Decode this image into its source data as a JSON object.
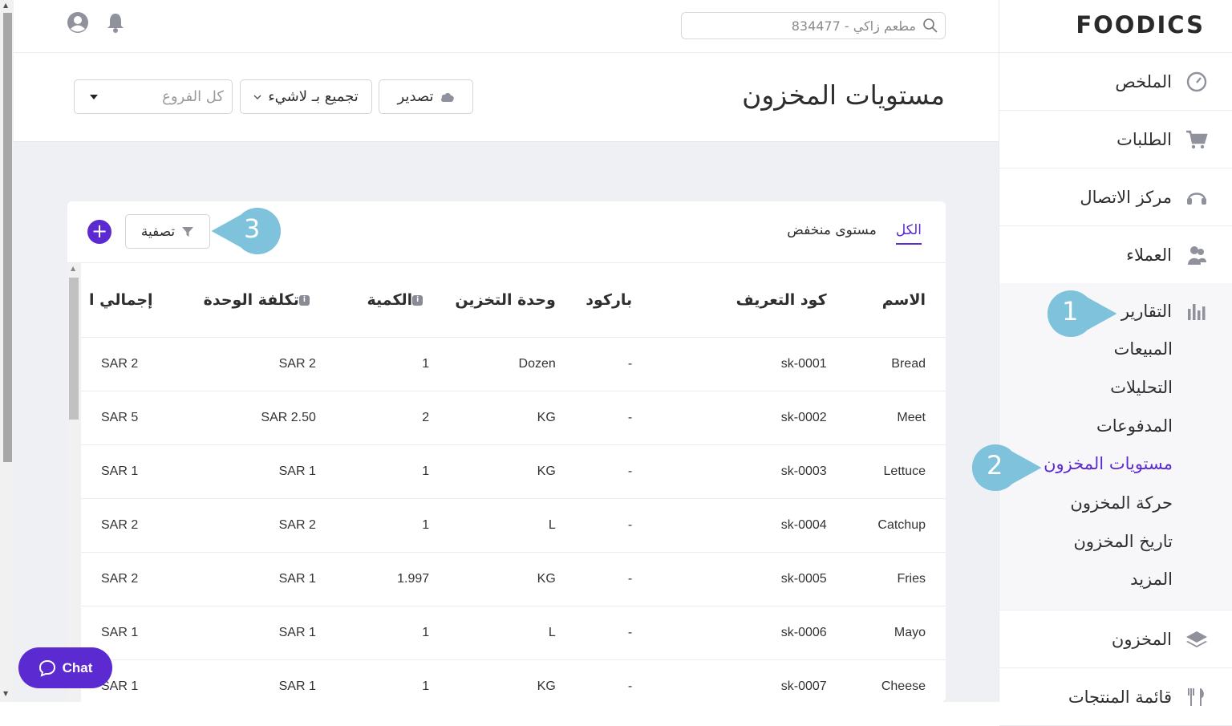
{
  "app": {
    "brand": "FOODICS",
    "search_placeholder": "مطعم زاكي - 834477"
  },
  "sidebar": {
    "items": [
      {
        "label": "الملخص",
        "icon": "dashboard-gauge-icon"
      },
      {
        "label": "الطلبات",
        "icon": "cart-icon"
      },
      {
        "label": "مركز الاتصال",
        "icon": "headset-icon"
      },
      {
        "label": "العملاء",
        "icon": "users-icon"
      }
    ],
    "reports": {
      "label": "التقارير",
      "icon": "bar-chart-icon",
      "sub": [
        "المبيعات",
        "التحليلات",
        "المدفوعات",
        "مستويات المخزون",
        "حركة المخزون",
        "تاريخ المخزون",
        "المزيد"
      ],
      "active": "مستويات المخزون"
    },
    "after": [
      {
        "label": "المخزون",
        "icon": "layers-icon"
      },
      {
        "label": "قائمة المنتجات",
        "icon": "fork-knife-icon"
      }
    ]
  },
  "header": {
    "title": "مستويات المخزون",
    "export_label": "تصدير",
    "group_label": "تجميع بـ لاشيء",
    "branches_label": "كل الفروع"
  },
  "card": {
    "tabs": [
      "الكل",
      "مستوى منخفض"
    ],
    "filter_label": "تصفية",
    "columns": [
      "الاسم",
      "كود التعريف",
      "باركود",
      "وحدة التخزين",
      "الكمية",
      "تكلفة الوحدة",
      "إجمالي ا"
    ],
    "rows": [
      [
        "Bread",
        "sk-0001",
        "-",
        "Dozen",
        "1",
        "SAR 2",
        "SAR 2"
      ],
      [
        "Meet",
        "sk-0002",
        "-",
        "KG",
        "2",
        "SAR 2.50",
        "SAR 5"
      ],
      [
        "Lettuce",
        "sk-0003",
        "-",
        "KG",
        "1",
        "SAR 1",
        "SAR 1"
      ],
      [
        "Catchup",
        "sk-0004",
        "-",
        "L",
        "1",
        "SAR 2",
        "SAR 2"
      ],
      [
        "Fries",
        "sk-0005",
        "-",
        "KG",
        "1.997",
        "SAR 1",
        "SAR 2"
      ],
      [
        "Mayo",
        "sk-0006",
        "-",
        "L",
        "1",
        "SAR 1",
        "SAR 1"
      ],
      [
        "Cheese",
        "sk-0007",
        "-",
        "KG",
        "1",
        "SAR 1",
        "SAR 1"
      ]
    ]
  },
  "callouts": [
    "1",
    "2",
    "3"
  ],
  "chat_label": "Chat",
  "colors": {
    "accent": "#5b2ad1",
    "callout": "#7ec3db"
  }
}
